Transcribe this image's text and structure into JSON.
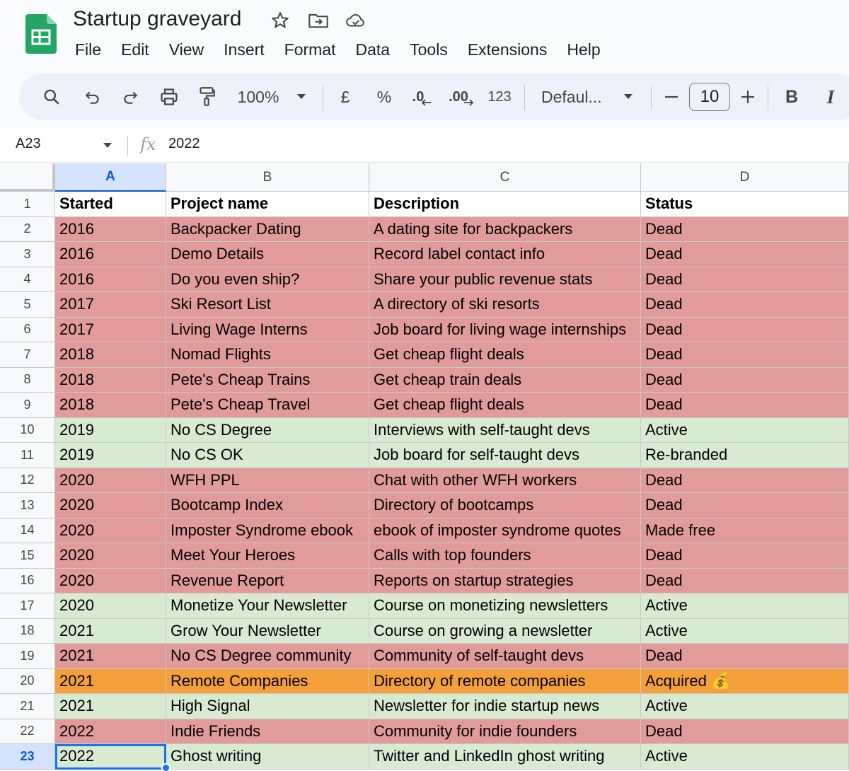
{
  "document": {
    "title": "Startup graveyard"
  },
  "menu": [
    "File",
    "Edit",
    "View",
    "Insert",
    "Format",
    "Data",
    "Tools",
    "Extensions",
    "Help"
  ],
  "toolbar": {
    "zoom": "100%",
    "currency": "£",
    "percent": "%",
    "decrease_decimal": ".0",
    "increase_decimal": ".00",
    "number_format": "123",
    "font": "Defaul...",
    "font_size": "10",
    "bold": "B",
    "italic": "I",
    "icons": [
      "search-icon",
      "undo-icon",
      "redo-icon",
      "print-icon",
      "paint-format-icon",
      "chevron-down-icon",
      "minus-icon",
      "plus-icon"
    ]
  },
  "formula_bar": {
    "cell_ref": "A23",
    "fx": "fx",
    "value": "2022"
  },
  "grid": {
    "columns": [
      "A",
      "B",
      "C",
      "D"
    ],
    "selected_column": "A",
    "selected_row": "23",
    "colors": {
      "dead": "#e19b9a",
      "active": "#d9ead3",
      "acquired": "#f3a03b",
      "header": "#ffffff",
      "selection": "#1a73e8"
    },
    "rows": [
      {
        "n": "1",
        "kind": "header",
        "cells": [
          "Started",
          "Project name",
          "Description",
          "Status"
        ]
      },
      {
        "n": "2",
        "kind": "dead",
        "cells": [
          "2016",
          "Backpacker Dating",
          "A dating site for backpackers",
          "Dead"
        ]
      },
      {
        "n": "3",
        "kind": "dead",
        "cells": [
          "2016",
          "Demo Details",
          "Record label contact info",
          "Dead"
        ]
      },
      {
        "n": "4",
        "kind": "dead",
        "cells": [
          "2016",
          "Do you even ship?",
          "Share your public revenue stats",
          "Dead"
        ]
      },
      {
        "n": "5",
        "kind": "dead",
        "cells": [
          "2017",
          "Ski Resort List",
          "A directory of ski resorts",
          "Dead"
        ]
      },
      {
        "n": "6",
        "kind": "dead",
        "cells": [
          "2017",
          "Living Wage Interns",
          "Job board for living wage internships",
          "Dead"
        ]
      },
      {
        "n": "7",
        "kind": "dead",
        "cells": [
          "2018",
          "Nomad Flights",
          "Get cheap flight deals",
          "Dead"
        ]
      },
      {
        "n": "8",
        "kind": "dead",
        "cells": [
          "2018",
          "Pete's Cheap Trains",
          "Get cheap train deals",
          "Dead"
        ]
      },
      {
        "n": "9",
        "kind": "dead",
        "cells": [
          "2018",
          "Pete's Cheap Travel",
          "Get cheap flight deals",
          "Dead"
        ]
      },
      {
        "n": "10",
        "kind": "active",
        "cells": [
          "2019",
          "No CS Degree",
          "Interviews with self-taught devs",
          "Active"
        ]
      },
      {
        "n": "11",
        "kind": "active",
        "cells": [
          "2019",
          "No CS OK",
          "Job board for self-taught devs",
          "Re-branded"
        ]
      },
      {
        "n": "12",
        "kind": "dead",
        "cells": [
          "2020",
          "WFH PPL",
          "Chat with other WFH workers",
          "Dead"
        ]
      },
      {
        "n": "13",
        "kind": "dead",
        "cells": [
          "2020",
          "Bootcamp Index",
          "Directory of bootcamps",
          "Dead"
        ]
      },
      {
        "n": "14",
        "kind": "dead",
        "cells": [
          "2020",
          "Imposter Syndrome ebook",
          "ebook of imposter syndrome quotes",
          "Made free"
        ]
      },
      {
        "n": "15",
        "kind": "dead",
        "cells": [
          "2020",
          "Meet Your Heroes",
          "Calls with top founders",
          "Dead"
        ]
      },
      {
        "n": "16",
        "kind": "dead",
        "cells": [
          "2020",
          "Revenue Report",
          "Reports on startup strategies",
          "Dead"
        ]
      },
      {
        "n": "17",
        "kind": "active",
        "cells": [
          "2020",
          "Monetize Your Newsletter",
          "Course on monetizing newsletters",
          "Active"
        ]
      },
      {
        "n": "18",
        "kind": "active",
        "cells": [
          "2021",
          "Grow Your Newsletter",
          "Course on growing a newsletter",
          "Active"
        ]
      },
      {
        "n": "19",
        "kind": "dead",
        "cells": [
          "2021",
          "No CS Degree community",
          "Community of self-taught devs",
          "Dead"
        ]
      },
      {
        "n": "20",
        "kind": "acquired",
        "cells": [
          "2021",
          "Remote Companies",
          "Directory of remote companies",
          "Acquired 💰"
        ]
      },
      {
        "n": "21",
        "kind": "active",
        "cells": [
          "2021",
          "High Signal",
          "Newsletter for indie startup news",
          "Active"
        ]
      },
      {
        "n": "22",
        "kind": "dead",
        "cells": [
          "2022",
          "Indie Friends",
          "Community for indie founders",
          "Dead"
        ]
      },
      {
        "n": "23",
        "kind": "active",
        "cells": [
          "2022",
          "Ghost writing",
          "Twitter and LinkedIn ghost writing",
          "Active"
        ]
      }
    ]
  }
}
